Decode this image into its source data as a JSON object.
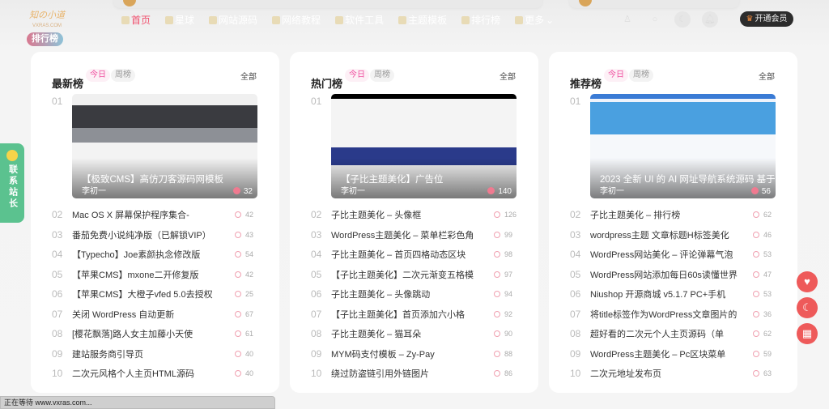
{
  "header": {
    "logo_text": "知の小道",
    "logo_sub": "VXRAS.COM",
    "nav": [
      {
        "label": "首页",
        "active": true
      },
      {
        "label": "星球"
      },
      {
        "label": "网站源码"
      },
      {
        "label": "网络教程"
      },
      {
        "label": "软件工具"
      },
      {
        "label": "主题模板"
      },
      {
        "label": "排行榜"
      },
      {
        "label": "更多"
      }
    ],
    "vip_label": "开通会员"
  },
  "rank_pill": "排行榜",
  "contact_label": "联系站长",
  "status_text": "正在等待 www.vxras.com...",
  "colors": {
    "accent": "#f0506e",
    "contact": "#5bc28f",
    "float": "#ee5a5a"
  },
  "cards": [
    {
      "title": "最新榜",
      "today": "今日",
      "week": "周榜",
      "all": "全部",
      "top": {
        "no": "01",
        "title": "【极致CMS】高仿刀客源码网模板",
        "author": "李初一",
        "views": "32"
      },
      "items": [
        [
          "02",
          "Mac OS X 屏幕保护程序集合-",
          "42"
        ],
        [
          "03",
          "番茄免费小说纯净版（已解锁VIP）",
          "43"
        ],
        [
          "04",
          "【Typecho】Joe素颜执念修改版",
          "54"
        ],
        [
          "05",
          "【苹果CMS】mxone二开修复版",
          "42"
        ],
        [
          "06",
          "【苹果CMS】大橙子vfed 5.0去授权",
          "25"
        ],
        [
          "07",
          "关闭 WordPress 自动更新",
          "67"
        ],
        [
          "08",
          "[樱花飘落]路人女主加藤小天使",
          "61"
        ],
        [
          "09",
          "建站服务商引导页",
          "40"
        ],
        [
          "10",
          "二次元风格个人主页HTML源码",
          "40"
        ]
      ]
    },
    {
      "title": "热门榜",
      "today": "今日",
      "week": "周榜",
      "all": "全部",
      "top": {
        "no": "01",
        "title": "【子比主题美化】广告位",
        "author": "李初一",
        "views": "140"
      },
      "items": [
        [
          "02",
          "子比主题美化 – 头像框",
          "126"
        ],
        [
          "03",
          "WordPress主题美化 – 菜单栏彩色角",
          "99"
        ],
        [
          "04",
          "子比主题美化 – 首页四格动态区块",
          "98"
        ],
        [
          "05",
          "【子比主题美化】二次元渐变五格模",
          "97"
        ],
        [
          "06",
          "子比主题美化 – 头像跳动",
          "94"
        ],
        [
          "07",
          "【子比主题美化】首页添加六小格",
          "92"
        ],
        [
          "08",
          "子比主题美化 – 猫耳朵",
          "90"
        ],
        [
          "09",
          "MYM码支付模板 – Zy-Pay",
          "88"
        ],
        [
          "10",
          "绕过防盗链引用外链图片",
          "86"
        ]
      ]
    },
    {
      "title": "推荐榜",
      "today": "今日",
      "week": "周榜",
      "all": "全部",
      "top": {
        "no": "01",
        "title": "2023 全新 UI 的 AI 网址导航系统源码 基于",
        "author": "李初一",
        "views": "56"
      },
      "items": [
        [
          "02",
          "子比主题美化 – 排行榜",
          "62"
        ],
        [
          "03",
          "wordpress主题 文章标题H标签美化",
          "46"
        ],
        [
          "04",
          "WordPress网站美化 – 评论弹幕气泡",
          "53"
        ],
        [
          "05",
          "WordPress网站添加每日60s读懂世界",
          "47"
        ],
        [
          "06",
          "Niushop 开源商城 v5.1.7 PC+手机",
          "53"
        ],
        [
          "07",
          "将title标签作为WordPress文章图片的",
          "36"
        ],
        [
          "08",
          "超好看的二次元个人主页源码（单",
          "62"
        ],
        [
          "09",
          "WordPress主题美化 – Pc区块菜单",
          "59"
        ],
        [
          "10",
          "二次元地址发布页",
          "63"
        ]
      ]
    }
  ]
}
